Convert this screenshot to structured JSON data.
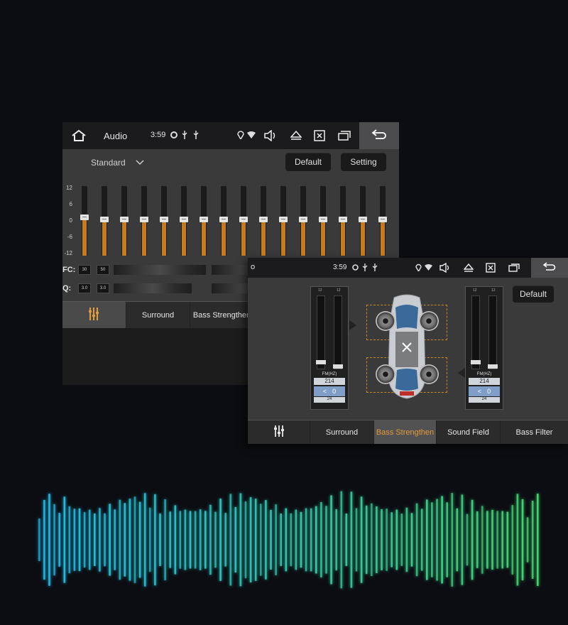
{
  "colors": {
    "accent": "#c57c1e",
    "active_tab_text": "#e39a3a",
    "wave_start": "#1fb7e8",
    "wave_end": "#3fd26b"
  },
  "screen1": {
    "status": {
      "home_icon": "home-icon",
      "title": "Audio",
      "time": "3:59",
      "icons": [
        "settings-icon",
        "usb-icon",
        "usb-icon",
        "location-icon",
        "wifi-icon",
        "volume-icon",
        "eject-icon",
        "close-box-icon",
        "windows-icon",
        "back-icon"
      ]
    },
    "preset": {
      "label": "Standard"
    },
    "buttons": {
      "default": "Default",
      "setting": "Setting"
    },
    "scale": [
      "12",
      "6",
      "0",
      "-6",
      "-12"
    ],
    "eq_levels": [
      0.55,
      0.52,
      0.52,
      0.52,
      0.52,
      0.52,
      0.52,
      0.52,
      0.52,
      0.52,
      0.52,
      0.52,
      0.52,
      0.52,
      0.52,
      0.52
    ],
    "fc": {
      "label": "FC:",
      "values": [
        "30",
        "50"
      ]
    },
    "q": {
      "label": "Q:",
      "values": [
        "3.0",
        "3.0"
      ]
    },
    "tabs": [
      "",
      "Surround",
      "Bass Strengthen"
    ]
  },
  "screen2": {
    "status": {
      "time": "3:59"
    },
    "buttons": {
      "default": "Default"
    },
    "left_panel": {
      "ticks_top": [
        "12",
        "12"
      ],
      "fm_label": "FM(HZ)",
      "fm_value": "214",
      "q_value": "0",
      "q2": "24"
    },
    "right_panel": {
      "ticks_top": [
        "12",
        "12"
      ],
      "fm_label": "FM(HZ)",
      "fm_value": "214",
      "q_value": "0",
      "q2": "24"
    },
    "tabs": [
      "",
      "Surround",
      "Bass Strengthen",
      "Sound Field",
      "Bass Filter"
    ],
    "active_tab": 2
  }
}
